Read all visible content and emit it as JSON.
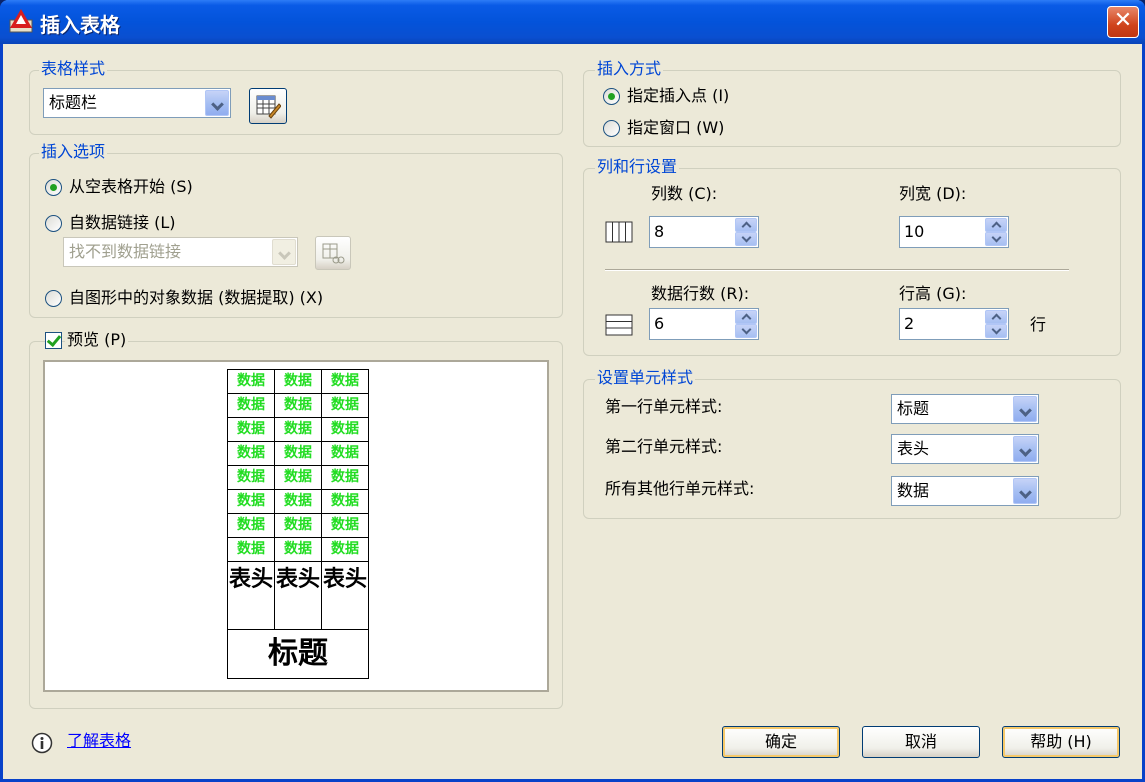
{
  "window": {
    "title": "插入表格",
    "close_label": "✕"
  },
  "table_style": {
    "legend": "表格样式",
    "selected": "标题栏"
  },
  "insert_options": {
    "legend": "插入选项",
    "from_empty": "从空表格开始 (S)",
    "from_data_link": "自数据链接 (L)",
    "data_link_value": "找不到数据链接",
    "from_object_data": "自图形中的对象数据 (数据提取) (X)"
  },
  "preview": {
    "label": "预览 (P)",
    "data_rows": [
      [
        "数据",
        "数据",
        "数据"
      ],
      [
        "数据",
        "数据",
        "数据"
      ],
      [
        "数据",
        "数据",
        "数据"
      ],
      [
        "数据",
        "数据",
        "数据"
      ],
      [
        "数据",
        "数据",
        "数据"
      ],
      [
        "数据",
        "数据",
        "数据"
      ],
      [
        "数据",
        "数据",
        "数据"
      ],
      [
        "数据",
        "数据",
        "数据"
      ]
    ],
    "header_row": [
      "表头",
      "表头",
      "表头"
    ],
    "title_row": "标题"
  },
  "insert_method": {
    "legend": "插入方式",
    "insert_point": "指定插入点 (I)",
    "window": "指定窗口 (W)"
  },
  "col_row_settings": {
    "legend": "列和行设置",
    "columns_label": "列数 (C):",
    "columns_value": "8",
    "col_width_label": "列宽 (D):",
    "col_width_value": "10",
    "data_rows_label": "数据行数 (R):",
    "data_rows_value": "6",
    "row_height_label": "行高 (G):",
    "row_height_value": "2",
    "row_unit": "行"
  },
  "cell_styles": {
    "legend": "设置单元样式",
    "first_row_label": "第一行单元样式:",
    "first_row_value": "标题",
    "second_row_label": "第二行单元样式:",
    "second_row_value": "表头",
    "other_rows_label": "所有其他行单元样式:",
    "other_rows_value": "数据"
  },
  "footer": {
    "learn_link": "了解表格",
    "ok": "确定",
    "cancel": "取消",
    "help": "帮助 (H)"
  },
  "colors": {
    "legend": "#0046d5",
    "data_text": "#22dd22",
    "titlebar": "#0353da"
  },
  "icons": [
    "app-icon",
    "close-icon",
    "table-style-edit-icon",
    "data-link-manager-icon",
    "columns-icon",
    "rows-icon",
    "info-icon"
  ]
}
